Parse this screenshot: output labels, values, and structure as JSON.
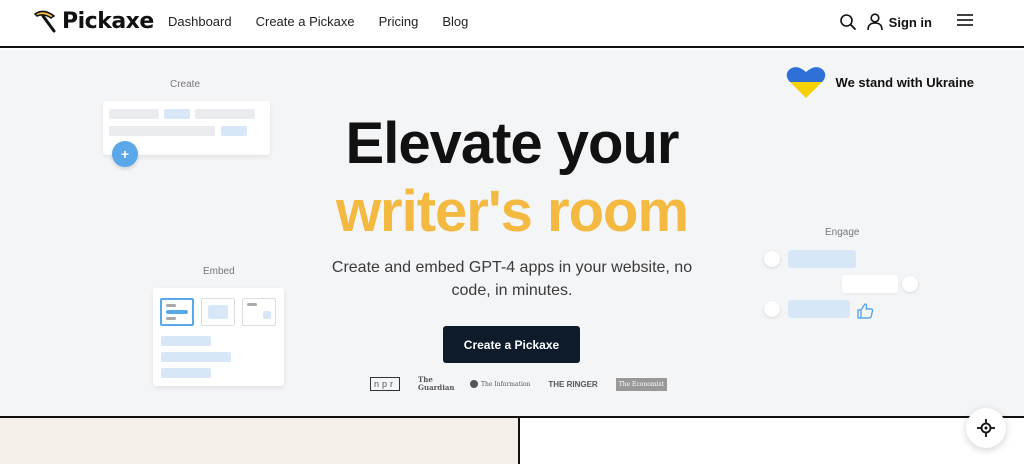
{
  "header": {
    "logo_text": "Pickaxe",
    "nav": [
      {
        "label": "Dashboard"
      },
      {
        "label": "Create a Pickaxe"
      },
      {
        "label": "Pricing"
      },
      {
        "label": "Blog"
      }
    ],
    "signin_label": "Sign in",
    "icons": {
      "search": "search-icon",
      "user": "user-icon",
      "menu": "hamburger-menu-icon",
      "logo": "pickaxe-icon"
    }
  },
  "hero": {
    "ukraine_text": "We stand with Ukraine",
    "title_line1": "Elevate your",
    "title_line2": "writer's room",
    "subtitle": "Create and embed GPT-4 apps in your website, no code, in minutes.",
    "cta_label": "Create a Pickaxe",
    "deco_labels": {
      "create": "Create",
      "embed": "Embed",
      "engage": "Engage"
    },
    "press": [
      "npr",
      "The Guardian",
      "The Information",
      "THE RINGER",
      "The Economist"
    ]
  },
  "colors": {
    "accent": "#f3b941",
    "cta_bg": "#0d1b2a",
    "ukraine_blue": "#2f6fd8",
    "ukraine_yellow": "#f5d100",
    "hero_bg": "#f4f5f7"
  }
}
